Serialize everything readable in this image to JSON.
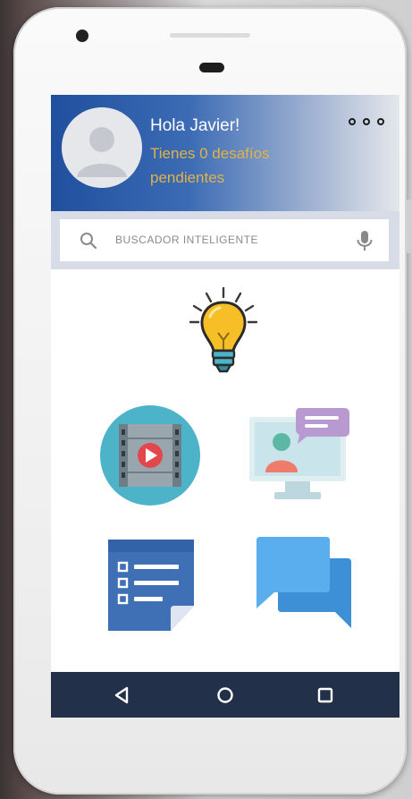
{
  "header": {
    "greeting": "Hola Javier!",
    "subtitle": "Tienes 0 desafíos pendientes"
  },
  "search": {
    "placeholder": "BUSCADOR INTELIGENTE"
  },
  "icons": {
    "avatar": "user-avatar-icon",
    "more": "more-options-icon",
    "search": "search-icon",
    "mic": "microphone-icon",
    "bulb": "lightbulb-icon",
    "video": "video-film-icon",
    "screen": "video-call-monitor-icon",
    "list": "checklist-note-icon",
    "chat": "chat-bubbles-icon",
    "nav_back": "back-triangle-icon",
    "nav_home": "home-circle-icon",
    "nav_recent": "recent-apps-square-icon"
  },
  "colors": {
    "header_blue": "#1f4f9e",
    "subtitle_gold": "#e0b349",
    "navbar": "#223149",
    "bulb_yellow": "#f6bf28",
    "teal": "#4cb3c9",
    "film_gray": "#6f7d86",
    "play_red": "#e2474b",
    "chat_blue": "#4a9fe3",
    "list_blue": "#3f6fb5",
    "purple_bubble": "#b89ad1"
  }
}
